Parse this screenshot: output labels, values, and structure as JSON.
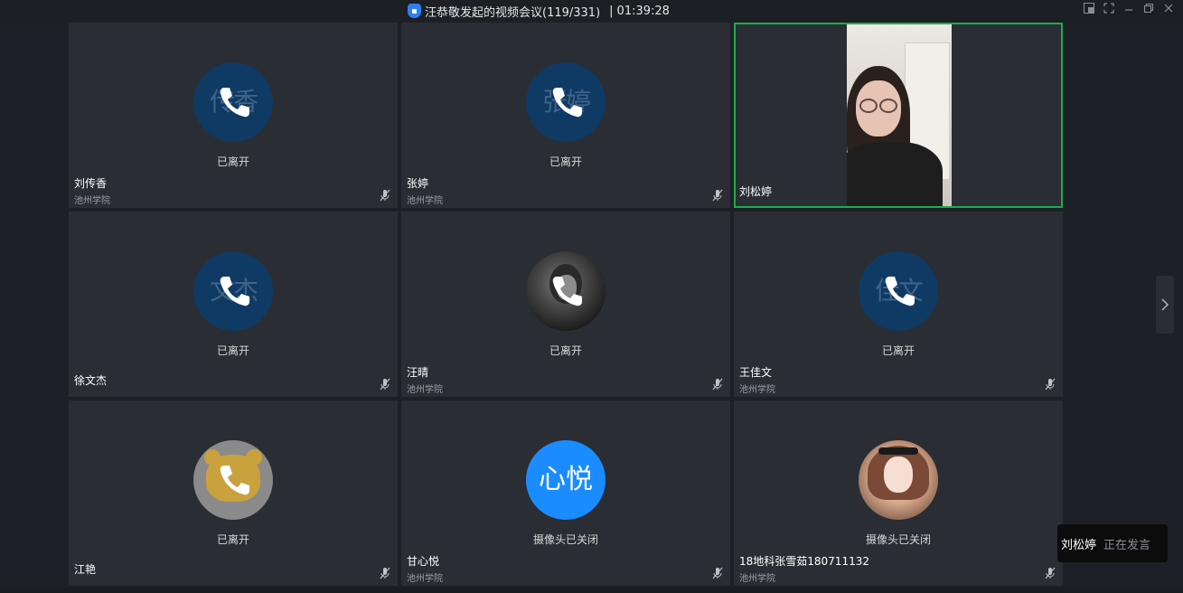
{
  "window": {
    "title": "汪恭敬发起的视频会议(119/331)",
    "separator": "|",
    "timer": "01:39:28"
  },
  "speaker_toast": {
    "name": "刘松婷",
    "status": "正在发言"
  },
  "tiles": [
    {
      "name": "刘传香",
      "org": "池州学院",
      "status": "已离开",
      "avatar_text": "传香",
      "avatar": "initials",
      "muted": true
    },
    {
      "name": "张婷",
      "org": "池州学院",
      "status": "已离开",
      "avatar_text": "张婷",
      "avatar": "initials",
      "muted": true
    },
    {
      "name": "刘松婷",
      "org": "",
      "status": "",
      "avatar": "video",
      "active_speaker": true
    },
    {
      "name": "徐文杰",
      "org": "",
      "status": "已离开",
      "avatar_text": "文杰",
      "avatar": "initials",
      "muted": true
    },
    {
      "name": "汪晴",
      "org": "池州学院",
      "status": "已离开",
      "avatar": "photo",
      "muted": true
    },
    {
      "name": "王佳文",
      "org": "池州学院",
      "status": "已离开",
      "avatar_text": "佳文",
      "avatar": "initials",
      "muted": true
    },
    {
      "name": "江艳",
      "org": "",
      "status": "已离开",
      "avatar": "photo",
      "muted": true
    },
    {
      "name": "甘心悦",
      "org": "池州学院",
      "status": "摄像头已关闭",
      "avatar_text": "心悦",
      "avatar": "initials-bright",
      "muted": true
    },
    {
      "name": "18地科张雪茹180711132",
      "org": "池州学院",
      "status": "摄像头已关闭",
      "avatar": "photo",
      "muted": true
    }
  ],
  "colors": {
    "background": "#1d2026",
    "tile": "#2a2d33",
    "active_speaker_border": "#1aaf4b",
    "avatar_dark_blue": "#0f3a64",
    "avatar_bright_blue": "#1a8cff",
    "lock_icon": "#2f80ed"
  },
  "icons": {
    "title_lock": "lock-shield-icon",
    "call": "phone-icon",
    "mute": "mic-off-icon",
    "next": "chevron-right-icon",
    "window_controls": [
      "pip-icon",
      "fullscreen-icon",
      "minimize-icon",
      "restore-icon",
      "close-icon"
    ]
  }
}
